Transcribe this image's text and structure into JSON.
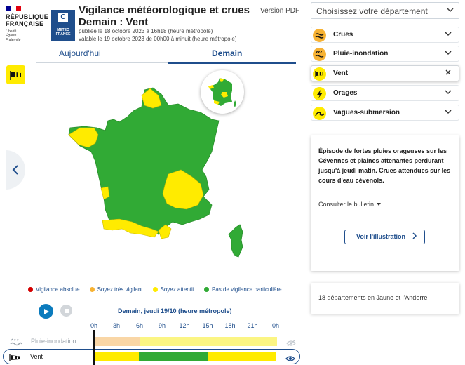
{
  "header": {
    "republique": "RÉPUBLIQUE\nFRANÇAISE",
    "motto": "Liberté\nÉgalité\nFraternité",
    "meteo_logo": "METEO\nFRANCE",
    "title_line1": "Vigilance météorologique et crues",
    "title_line2": "Demain : Vent",
    "published": "publiée le 18 octobre 2023 à 16h18 (heure métropole)",
    "valid": "valable le 19 octobre 2023 de 00h00 à minuit (heure métropole)",
    "pdf_label": "Version PDF"
  },
  "tabs": [
    {
      "label": "Aujourd'hui"
    },
    {
      "label": "Demain"
    }
  ],
  "legend": [
    {
      "label": "Vigilance absolue",
      "color": "#d40000"
    },
    {
      "label": "Soyez très vigilant",
      "color": "#f7b233"
    },
    {
      "label": "Soyez attentif",
      "color": "#ffeb00"
    },
    {
      "label": "Pas de vigilance particulière",
      "color": "#31aa35"
    }
  ],
  "timeline": {
    "title": "Demain, jeudi 19/10 (heure métropole)",
    "hours": [
      "0h",
      "3h",
      "6h",
      "9h",
      "12h",
      "15h",
      "18h",
      "21h",
      "0h"
    ],
    "rows": [
      {
        "label": "Pluie-inondation"
      },
      {
        "label": "Vent"
      }
    ]
  },
  "department_select": {
    "value": "Choisissez votre département"
  },
  "risks": [
    {
      "label": "Crues"
    },
    {
      "label": "Pluie-inondation"
    },
    {
      "label": "Vent"
    },
    {
      "label": "Orages"
    },
    {
      "label": "Vagues-submersion"
    }
  ],
  "bulletin": {
    "text": "Épisode de fortes pluies orageuses sur les Cévennes et plaines attenantes perdurant jusqu'à jeudi matin. Crues attendues sur les cours d'eau cévenols.",
    "link": "Consulter le bulletin",
    "button": "Voir l'illustration"
  },
  "summary": {
    "text": "18 départements en Jaune et l'Andorre"
  },
  "colors": {
    "yellow": "#ffeb00",
    "green": "#31aa35",
    "orange": "#f7b233",
    "blue": "#1f4e8c"
  }
}
